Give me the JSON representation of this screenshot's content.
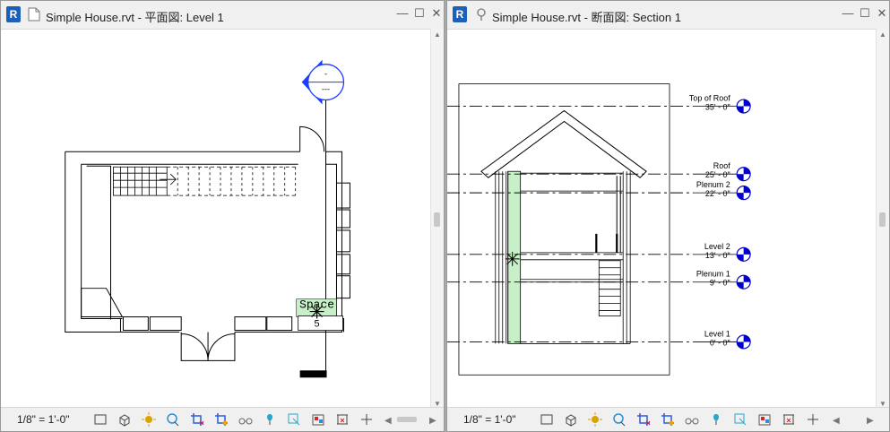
{
  "left_window": {
    "app_icon": "R",
    "title": "Simple House.rvt - 平面図: Level 1",
    "scale": "1/8\" = 1'-0\"",
    "tag_top": "-",
    "tag_bottom": "---",
    "space_label": "Space",
    "space_number": "5"
  },
  "right_window": {
    "app_icon": "R",
    "title": "Simple House.rvt - 断面図: Section 1",
    "scale": "1/8\" = 1'-0\"",
    "levels": [
      {
        "name": "Top of Roof",
        "elevation": "35' - 0\""
      },
      {
        "name": "Roof",
        "elevation": "25' - 0\""
      },
      {
        "name": "Plenum 2",
        "elevation": "22' - 0\""
      },
      {
        "name": "Level 2",
        "elevation": "13' - 0\""
      },
      {
        "name": "Plenum 1",
        "elevation": "9' - 0\""
      },
      {
        "name": "Level 1",
        "elevation": "0' - 0\""
      }
    ]
  },
  "window_controls": {
    "minimize": "—",
    "maximize": "☐",
    "close": "✕"
  },
  "toolbar_icons": [
    "detail-level-icon",
    "visual-style-icon",
    "sun-path-icon",
    "shadows-icon",
    "crop-view-icon",
    "crop-region-visibility-icon",
    "temporary-hide-icon",
    "reveal-hidden-icon",
    "worksharing-icon",
    "design-options-icon",
    "analytical-model-icon",
    "highlight-displacement-icon"
  ],
  "colors": {
    "accent": "#1c5fb8",
    "level_head": "#0000cc",
    "space_fill": "#c8f0c8"
  }
}
